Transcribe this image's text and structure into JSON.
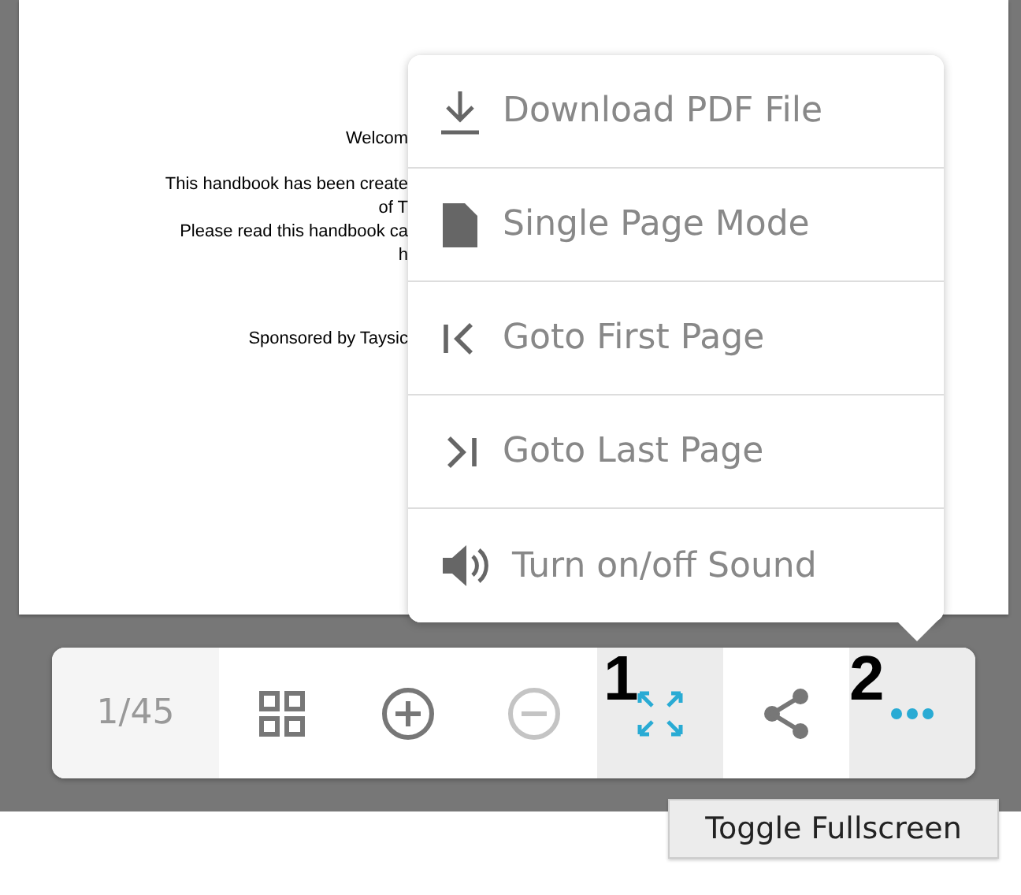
{
  "document_page": {
    "paragraphs": [
      [
        "Welcom"
      ],
      [
        "This handbook has been create",
        "of T",
        "Please read this handbook ca",
        "h"
      ],
      [
        "Sponsored by Taysic"
      ]
    ]
  },
  "menu": {
    "items": [
      {
        "kind": "download",
        "label": "Download PDF File"
      },
      {
        "kind": "page",
        "label": "Single Page Mode"
      },
      {
        "kind": "first",
        "label": "Goto First Page"
      },
      {
        "kind": "last",
        "label": "Goto Last Page"
      },
      {
        "kind": "sound",
        "label": "Turn on/off Sound"
      }
    ]
  },
  "toolbar": {
    "page_counter": "1/45",
    "buttons": [
      {
        "kind": "grid",
        "disabled": false,
        "selected": false
      },
      {
        "kind": "zoom_in",
        "disabled": false,
        "selected": false
      },
      {
        "kind": "zoom_out",
        "disabled": true,
        "selected": false
      },
      {
        "kind": "fullscreen",
        "disabled": false,
        "selected": true,
        "annotation": "1"
      },
      {
        "kind": "share",
        "disabled": false,
        "selected": false
      },
      {
        "kind": "more",
        "disabled": false,
        "selected": true,
        "annotation": "2"
      }
    ]
  },
  "tooltip": "Toggle Fullscreen"
}
